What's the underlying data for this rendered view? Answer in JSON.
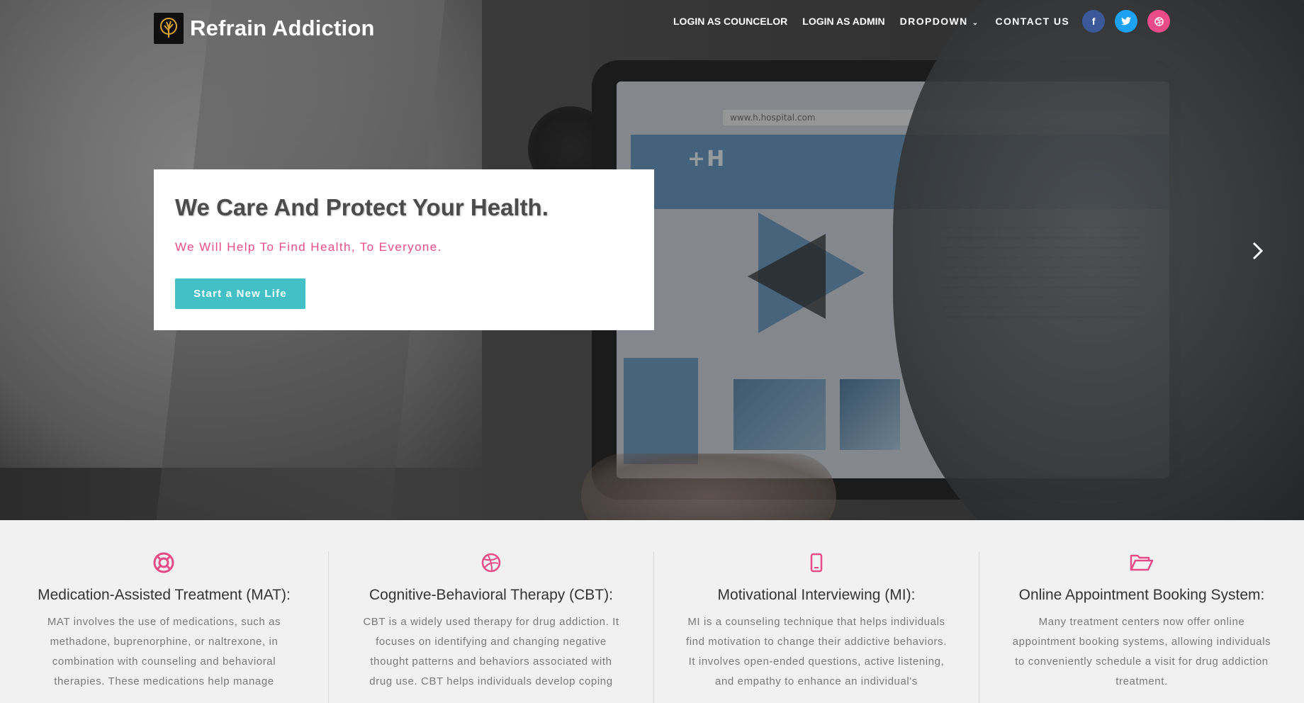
{
  "brand": {
    "name": "Refrain Addiction",
    "logo_icon": "tree-head-logo-icon"
  },
  "nav": {
    "login_counselor": "LOGIN AS COUNCELOR",
    "login_admin": "LOGIN AS ADMIN",
    "dropdown": "DROPDOWN",
    "contact": "CONTACT US",
    "social": [
      {
        "name": "facebook-icon",
        "glyph": "f",
        "color": "#3b5998"
      },
      {
        "name": "twitter-icon",
        "glyph": "🐦",
        "color": "#1da1f2"
      },
      {
        "name": "dribbble-icon",
        "glyph": "◎",
        "color": "#ea4c89"
      }
    ]
  },
  "hero": {
    "title": "We Care And Protect Your Health.",
    "subtitle": "We Will Help To Find Health, To Everyone.",
    "button_label": "Start a New Life",
    "screen_url": "www.h.hospital.com",
    "screen_brand": "+H",
    "next_icon": "chevron-right-icon"
  },
  "features": [
    {
      "icon": "life-ring-icon",
      "title": "Medication-Assisted Treatment (MAT):",
      "text": "MAT involves the use of medications, such as methadone, buprenorphine, or naltrexone, in combination with counseling and behavioral therapies. These medications help manage"
    },
    {
      "icon": "dribbble-ball-icon",
      "title": "Cognitive-Behavioral Therapy (CBT):",
      "text": "CBT is a widely used therapy for drug addiction. It focuses on identifying and changing negative thought patterns and behaviors associated with drug use. CBT helps individuals develop coping"
    },
    {
      "icon": "mobile-phone-icon",
      "title": "Motivational Interviewing (MI):",
      "text": "MI is a counseling technique that helps individuals find motivation to change their addictive behaviors. It involves open-ended questions, active listening, and empathy to enhance an individual's"
    },
    {
      "icon": "open-folder-icon",
      "title": "Online Appointment Booking System:",
      "text": "Many treatment centers now offer online appointment booking systems, allowing individuals to conveniently schedule a visit for drug addiction treatment."
    }
  ],
  "colors": {
    "accent_pink": "#e84c88",
    "accent_teal": "#43bfc6"
  }
}
